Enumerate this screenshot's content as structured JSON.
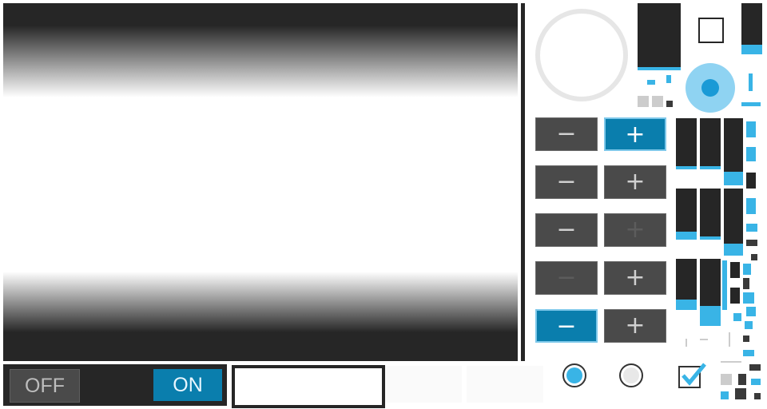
{
  "toggle": {
    "off_label": "OFF",
    "on_label": "ON",
    "state": "on"
  },
  "text_field": {
    "value": ""
  },
  "radios": [
    {
      "checked": true
    },
    {
      "checked": false
    }
  ],
  "checkbox": {
    "checked": true
  },
  "steppers": [
    {
      "minus": "−",
      "plus": "+",
      "active": "plus"
    },
    {
      "minus": "−",
      "plus": "+",
      "active": "none"
    },
    {
      "minus": "−",
      "plus": "+",
      "active": "none",
      "plus_disabled": true
    },
    {
      "minus": "−",
      "plus": "+",
      "active": "none",
      "minus_disabled": true
    },
    {
      "minus": "−",
      "plus": "+",
      "active": "minus"
    }
  ],
  "level_bars": [
    {
      "level": 0.06
    },
    {
      "level": 0.06
    },
    {
      "level": 0.2
    },
    {
      "level": 0.16
    },
    {
      "level": 0.06
    },
    {
      "level": 0.18
    },
    {
      "level": 0.2
    },
    {
      "level": 0.3
    }
  ],
  "colors": {
    "accent": "#39b4e6",
    "accent_dark": "#0a7ead",
    "panel_dark": "#262626",
    "button_gray": "#4a4a4a"
  },
  "icons": [
    "minus-icon",
    "plus-icon",
    "checkmark-icon"
  ]
}
